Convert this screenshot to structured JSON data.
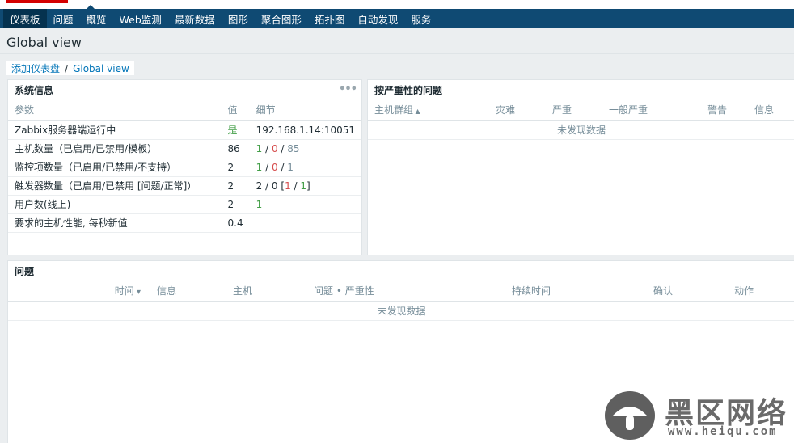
{
  "nav": {
    "items": [
      "仪表板",
      "问题",
      "概览",
      "Web监测",
      "最新数据",
      "图形",
      "聚合图形",
      "拓扑图",
      "自动发现",
      "服务"
    ]
  },
  "page": {
    "title": "Global view"
  },
  "breadcrumb": {
    "root": "添加仪表盘",
    "sep": "/",
    "current": "Global view"
  },
  "sysinfo": {
    "title": "系统信息",
    "menu_icon": "ellipsis-icon",
    "headers": {
      "param": "参数",
      "value": "值",
      "detail": "细节"
    },
    "rows": [
      {
        "param": "Zabbix服务器端运行中",
        "value": "是",
        "detail": "192.168.1.14:10051"
      },
      {
        "param": "主机数量（已启用/已禁用/模板）",
        "value": "86",
        "d1": "1",
        "s1": " / ",
        "d2": "0",
        "s2": " / ",
        "d3": "85"
      },
      {
        "param": "监控项数量（已启用/已禁用/不支持）",
        "value": "2",
        "d1": "1",
        "s1": " / ",
        "d2": "0",
        "s2": " / ",
        "d3": "1"
      },
      {
        "param": "触发器数量（已启用/已禁用 [问题/正常]）",
        "value": "2",
        "pre": "2 / 0 [",
        "d1": "1",
        "s1": " / ",
        "d2": "1",
        "post": "]"
      },
      {
        "param": "用户数(线上)",
        "value": "2",
        "detail": "1"
      },
      {
        "param": "要求的主机性能, 每秒新值",
        "value": "0.4",
        "detail": ""
      }
    ]
  },
  "severity": {
    "title": "按严重性的问题",
    "headers": {
      "group": "主机群组",
      "disaster": "灾难",
      "high": "严重",
      "average": "一般严重",
      "warning": "警告",
      "info": "信息"
    },
    "nodata": "未发现数据"
  },
  "problems": {
    "title": "问题",
    "headers": {
      "time": "时间",
      "info": "信息",
      "host": "主机",
      "problem": "问题 • 严重性",
      "duration": "持续时间",
      "ack": "确认",
      "actions": "动作"
    },
    "nodata": "未发现数据"
  },
  "watermark": {
    "cn": "黑区网络",
    "url": "www.heiqu.com",
    "icon": "mushroom-logo-icon"
  }
}
